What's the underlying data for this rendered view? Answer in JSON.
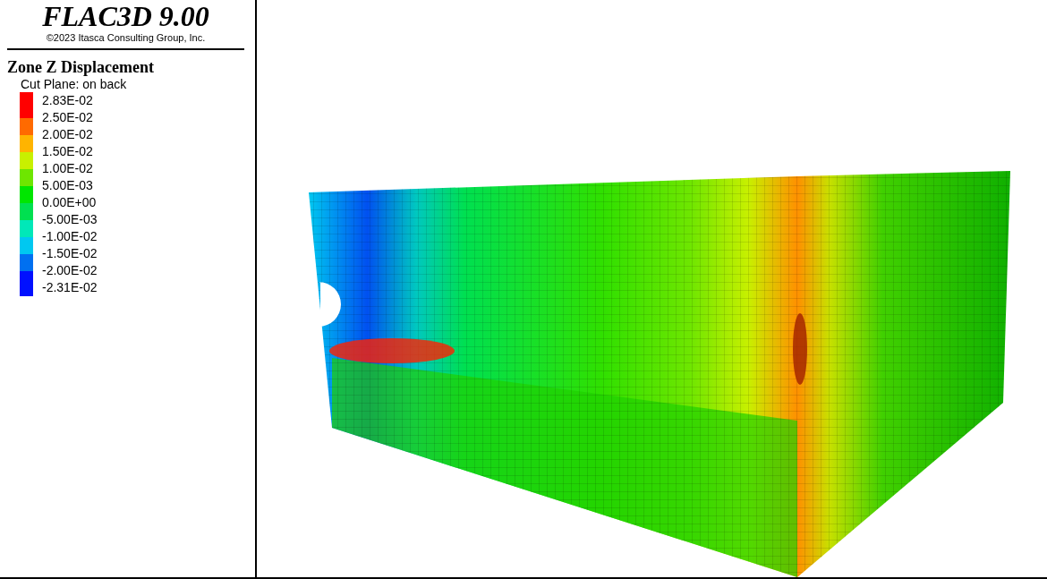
{
  "header": {
    "title": "FLAC3D 9.00",
    "copyright": "©2023 Itasca Consulting Group, Inc."
  },
  "legend": {
    "title": "Zone Z Displacement",
    "subtitle": "Cut Plane: on back",
    "bands": [
      {
        "color": "#ff0000"
      },
      {
        "color": "#ff6a00"
      },
      {
        "color": "#ffb400"
      },
      {
        "color": "#c8f000"
      },
      {
        "color": "#6ee600"
      },
      {
        "color": "#00e600"
      },
      {
        "color": "#00e050"
      },
      {
        "color": "#00e8b8"
      },
      {
        "color": "#00c8f0"
      },
      {
        "color": "#0070f0"
      },
      {
        "color": "#0010ff"
      }
    ],
    "labels": [
      "2.83E-02",
      "2.50E-02",
      "2.00E-02",
      "1.50E-02",
      "1.00E-02",
      "5.00E-03",
      "0.00E+00",
      "-5.00E-03",
      "-1.00E-02",
      "-1.50E-02",
      "-2.00E-02",
      "-2.31E-02"
    ]
  }
}
